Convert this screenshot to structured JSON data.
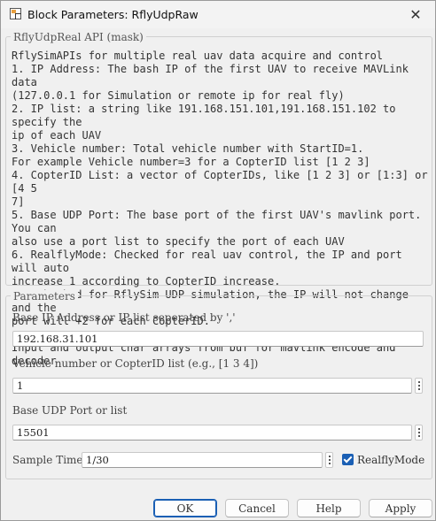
{
  "window": {
    "title": "Block Parameters: RflyUdpRaw",
    "close_glyph": "✕"
  },
  "mask_group": {
    "legend": "RflyUdpReal API (mask)",
    "description": "RflySimAPIs for multiple real uav data acquire and control\n1. IP Address: The bash IP of the first UAV to receive MAVLink data\n(127.0.0.1 for Simulation or remote ip for real fly)\n2. IP list: a string like 191.168.151.101,191.168.151.102 to specify the\nip of each UAV\n3. Vehicle number: Total vehicle number with StartID=1.\nFor example Vehicle number=3 for a CopterID list [1 2 3]\n4. CopterID List: a vector of CopterIDs, like [1 2 3] or [1:3] or [4 5\n7]\n5. Base UDP Port: The base port of the first UAV's mavlink port. You can\nalso use a port list to specify the port of each UAV\n6. RealflyMode: Checked for real uav control, the IP and port will auto\nincrease 1 according to CopterID increase.\nNot checked for RflySim UDP simulation, the IP will not change and the\nport will +2 for each CopterID.\n\nInput and output char arrays from buf for mavlink encode and decoder"
  },
  "parameters": {
    "legend": "Parameters",
    "ip_label": "Base IP Address or IP list seperated by ','",
    "ip_value": "192.168.31.101",
    "vehicle_label": "Vehicle number or CopterID list (e.g., [1 3 4])",
    "vehicle_value": "1",
    "port_label": "Base UDP Port or list",
    "port_value": "15501",
    "sample_label": "Sample Time",
    "sample_value": "1/30",
    "realfly_label": "RealflyMode",
    "realfly_checked": true
  },
  "buttons": {
    "ok": "OK",
    "cancel": "Cancel",
    "help": "Help",
    "apply": "Apply"
  },
  "colors": {
    "accent": "#1a5fb4",
    "background": "#f0f0f0"
  }
}
